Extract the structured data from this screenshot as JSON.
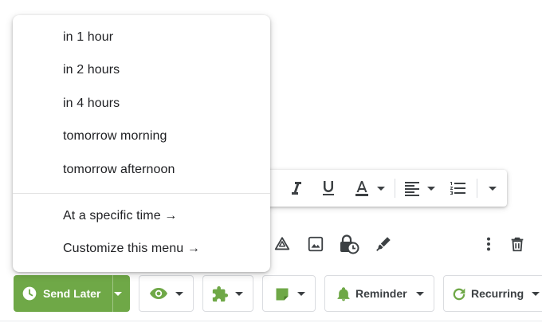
{
  "send_later_menu": {
    "items": [
      {
        "label": "in 1 hour"
      },
      {
        "label": "in 2 hours"
      },
      {
        "label": "in 4 hours"
      },
      {
        "label": "tomorrow morning"
      },
      {
        "label": "tomorrow afternoon"
      }
    ],
    "actions": [
      {
        "label": "At a specific time →"
      },
      {
        "label": "Customize this menu →"
      }
    ]
  },
  "formatting_toolbar": {
    "icons": [
      "italic-icon",
      "underline-icon",
      "text-color-icon",
      "align-icon",
      "numbered-list-icon",
      "more-formatting-icon"
    ]
  },
  "compose_icons": [
    "drive-icon",
    "photo-icon",
    "confidential-mode-icon",
    "signature-icon",
    "more-options-icon",
    "trash-icon"
  ],
  "bottom_bar": {
    "send_later_label": "Send Later",
    "reminder_label": "Reminder",
    "recurring_label": "Recurring"
  },
  "colors": {
    "accent_green": "#6fa847",
    "icon_dark": "#3c4043"
  }
}
